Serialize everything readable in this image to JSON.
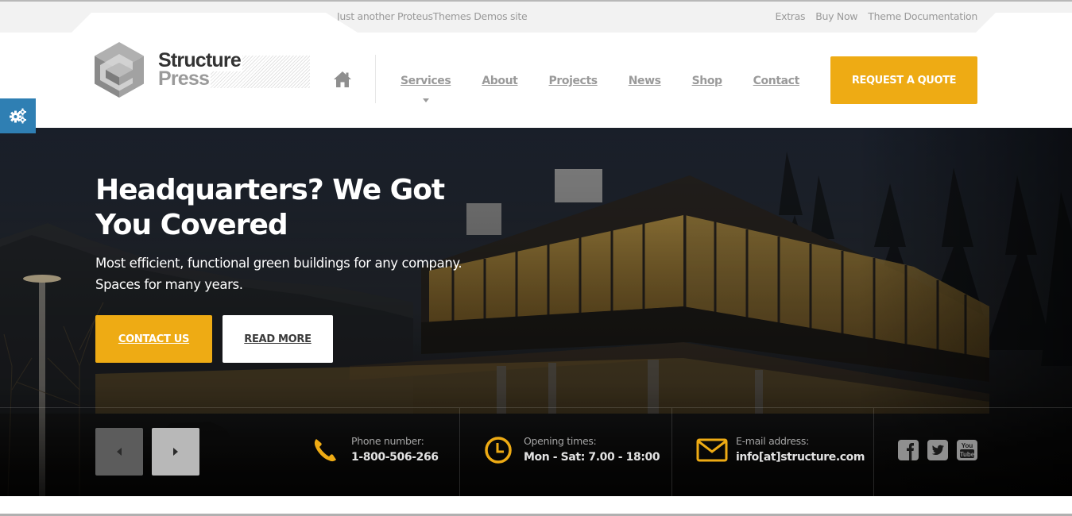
{
  "topbar": {
    "tagline": "Just another ProteusThemes Demos site",
    "links": [
      "Extras",
      "Buy Now",
      "Theme Documentation"
    ]
  },
  "logo": {
    "line1": "Structure",
    "line2": "Press"
  },
  "nav": {
    "home_icon": "home-icon",
    "items": [
      {
        "label": "Services",
        "has_dropdown": true
      },
      {
        "label": "About"
      },
      {
        "label": "Projects"
      },
      {
        "label": "News"
      },
      {
        "label": "Shop"
      },
      {
        "label": "Contact"
      }
    ],
    "cta_label": "REQUEST A QUOTE"
  },
  "settings": {
    "icon": "gears-icon"
  },
  "hero": {
    "title": "Headquarters? We Got You Covered",
    "subtitle": "Most efficient, functional green buildings for any company. Spaces for many years.",
    "primary_button": "CONTACT US",
    "secondary_button": "READ MORE"
  },
  "slider": {
    "prev_icon": "caret-left-icon",
    "next_icon": "caret-right-icon"
  },
  "info": [
    {
      "icon": "phone-icon",
      "label": "Phone number:",
      "value": "1-800-506-266"
    },
    {
      "icon": "clock-icon",
      "label": "Opening times:",
      "value": "Mon - Sat: 7.00 - 18:00"
    },
    {
      "icon": "envelope-icon",
      "label": "E-mail address:",
      "value": "info[at]structure.com"
    }
  ],
  "social": [
    "facebook-icon",
    "twitter-icon",
    "youtube-icon"
  ],
  "colors": {
    "accent": "#eeab14",
    "settings_blue": "#2f7fb3",
    "nav_text": "#9a9a9a",
    "topbar_bg": "#f2f2f2"
  }
}
